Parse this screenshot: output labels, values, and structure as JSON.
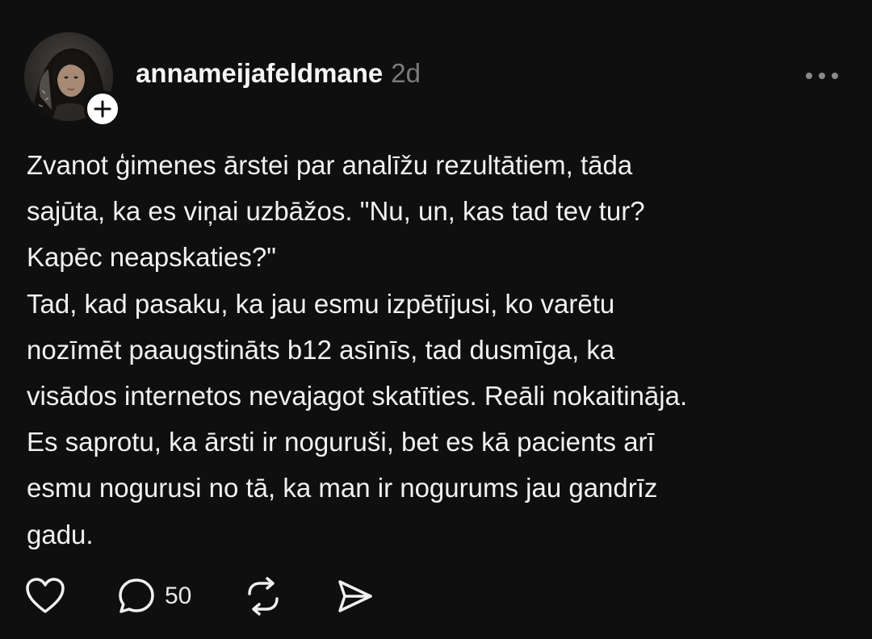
{
  "post": {
    "author": {
      "username": "annameijafeldmane",
      "time_ago": "2d",
      "avatar_icon": "avatar-photo",
      "follow_icon": "plus-icon"
    },
    "text": "Zvanot ģimenes ārstei par analīžu rezultātiem, tāda\nsajūta, ka es viņai uzbāžos. \"Nu, un, kas tad tev tur?\nKapēc neapskaties?\"\nTad, kad pasaku, ka jau esmu izpētījusi, ko varētu\nnozīmēt paaugstināts b12 asīnīs, tad dusmīga, ka\nvisādos internetos nevajagot skatīties. Reāli nokaitināja.\nEs saprotu, ka ārsti ir noguruši, bet es kā pacients arī\nesmu nogurusi no tā, ka man ir nogurums jau gandrīz\ngadu.",
    "actions": {
      "like_icon": "heart-icon",
      "reply_icon": "speech-bubble-icon",
      "reply_count": "50",
      "repost_icon": "repost-icon",
      "share_icon": "send-icon"
    },
    "more_icon": "more-options-icon"
  },
  "colors": {
    "background": "#0f0f0f",
    "text": "#f1f1f1",
    "muted": "#7b7b7b",
    "badge": "#ffffff"
  }
}
